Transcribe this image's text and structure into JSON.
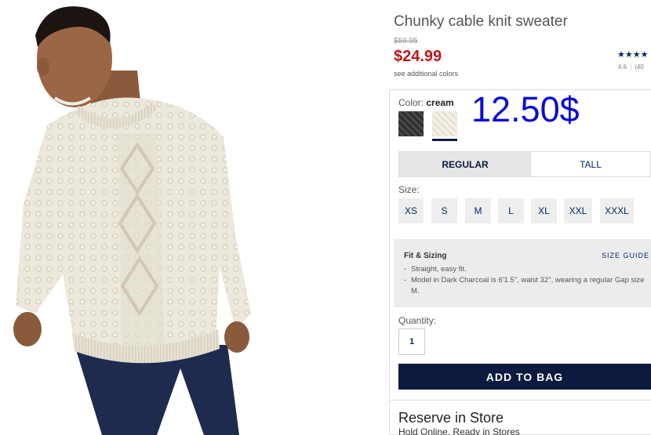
{
  "product": {
    "title": "Chunky cable knit sweater",
    "original_price": "$59.95",
    "sale_price": "$24.99",
    "colors_link": "see additional colors",
    "stars": "★★★★",
    "rating": "4.6",
    "review_count": "(40"
  },
  "color": {
    "label": "Color:",
    "selected": "cream",
    "swatches": [
      "charcoal",
      "cream"
    ]
  },
  "annotation": "12.50$",
  "fit_tabs": [
    "REGULAR",
    "TALL"
  ],
  "size": {
    "label": "Size:",
    "options": [
      "XS",
      "S",
      "M",
      "L",
      "XL",
      "XXL",
      "XXXL"
    ]
  },
  "fit_sizing": {
    "title": "Fit & Sizing",
    "guide_link": "SIZE GUIDE",
    "items": [
      "Straight, easy fit.",
      "Model in Dark Charcoal is 6'1.5\", waist 32\", wearing a regular Gap size M."
    ]
  },
  "quantity": {
    "label": "Quantity:",
    "value": "1"
  },
  "add_button": "ADD TO BAG",
  "reserve": {
    "title": "Reserve in Store",
    "subtitle": "Hold Online, Ready in Stores"
  },
  "colors": {
    "price_red": "#c0161d",
    "navy": "#0d1a3f",
    "link_blue": "#002868",
    "annotation_blue": "#0a0ad8"
  }
}
